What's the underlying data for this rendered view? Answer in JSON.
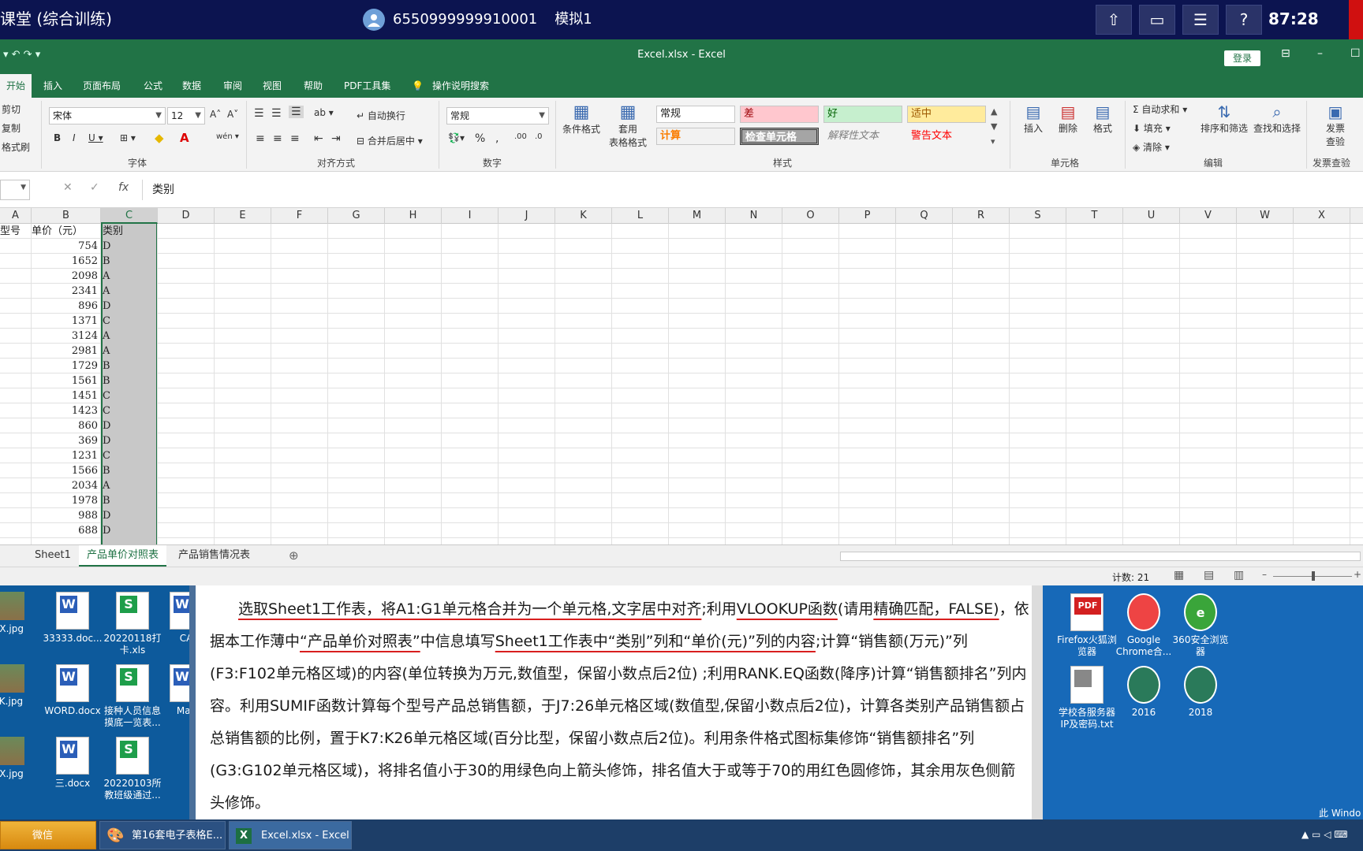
{
  "exam": {
    "title": "课堂 (综合训练)",
    "user_id": "6550999999910001",
    "mode": "模拟1",
    "timer": "87:28",
    "buttons": [
      "⇧",
      "▭",
      "☰",
      "?"
    ]
  },
  "excel": {
    "window_title": "Excel.xlsx  -  Excel",
    "login": "登录",
    "tabs": [
      "开始",
      "插入",
      "页面布局",
      "公式",
      "数据",
      "审阅",
      "视图",
      "帮助",
      "PDF工具集",
      "操作说明搜索"
    ],
    "ribbon": {
      "clipboard": [
        "剪切",
        "复制",
        "格式刷"
      ],
      "font_name": "宋体",
      "font_size": "12",
      "font_group": "字体",
      "align_group": "对齐方式",
      "wrap": "自动换行",
      "merge": "合并后居中",
      "number_format": "常规",
      "number_group": "数字",
      "cond_format": "条件格式",
      "table_format": "套用\n表格格式",
      "styles": [
        "常规",
        "差",
        "好",
        "适中",
        "计算",
        "检查单元格",
        "解释性文本",
        "警告文本"
      ],
      "styles_group": "样式",
      "cells": [
        "插入",
        "删除",
        "格式"
      ],
      "cells_group": "单元格",
      "edit": [
        "自动求和",
        "填充",
        "清除",
        "排序和筛选",
        "查找和选择"
      ],
      "edit_group": "编辑",
      "invoice": "发票\n查验",
      "invoice_group": "发票查验"
    },
    "formula": {
      "content": "类别"
    },
    "columns": [
      "A",
      "B",
      "C",
      "D",
      "E",
      "F",
      "G",
      "H",
      "I",
      "J",
      "K",
      "L",
      "M",
      "N",
      "O",
      "P",
      "Q",
      "R",
      "S",
      "T",
      "U",
      "V",
      "W",
      "X"
    ],
    "headers": {
      "a": "型号",
      "b": "单价（元）",
      "c": "类别"
    },
    "rows": [
      [
        "754",
        "D"
      ],
      [
        "1652",
        "B"
      ],
      [
        "2098",
        "A"
      ],
      [
        "2341",
        "A"
      ],
      [
        "896",
        "D"
      ],
      [
        "1371",
        "C"
      ],
      [
        "3124",
        "A"
      ],
      [
        "2981",
        "A"
      ],
      [
        "1729",
        "B"
      ],
      [
        "1561",
        "B"
      ],
      [
        "1451",
        "C"
      ],
      [
        "1423",
        "C"
      ],
      [
        "860",
        "D"
      ],
      [
        "369",
        "D"
      ],
      [
        "1231",
        "C"
      ],
      [
        "1566",
        "B"
      ],
      [
        "2034",
        "A"
      ],
      [
        "1978",
        "B"
      ],
      [
        "988",
        "D"
      ],
      [
        "688",
        "D"
      ]
    ],
    "sheets": [
      "Sheet1",
      "产品单价对照表",
      "产品销售情况表"
    ],
    "active_sheet": 1,
    "status_count": "计数: 21"
  },
  "question": {
    "text": "选取Sheet1工作表，将A1:G1单元格合并为一个单元格,文字居中对齐;利用VLOOKUP函数(请用精确匹配，FALSE)，依据本工作薄中“产品单价对照表”中信息填写Sheet1工作表中“类别”列和“单价(元)”列的内容;计算“销售额(万元)”列(F3:F102单元格区域)的内容(单位转换为万元,数值型，保留小数点后2位) ;利用RANK.EQ函数(降序)计算“销售额排名”列内容。利用SUMIF函数计算每个型号产品总销售额，于J7:26单元格区域(数值型,保留小数点后2位)，计算各类别产品销售额占总销售额的比例，置于K7:K26单元格区域(百分比型，保留小数点后2位)。利用条件格式图标集修饰“销售额排名”列(G3:G102单元格区域)，将排名值小于30的用绿色向上箭头修饰，排名值大于或等于70的用红色圆修饰，其余用灰色侧箭头修饰。"
  },
  "desktop": {
    "left_icons": [
      {
        "label": "GX.jpg",
        "type": "photo"
      },
      {
        "label": "33333.doc...",
        "type": "doc"
      },
      {
        "label": "20220118打卡.xls",
        "type": "xls"
      },
      {
        "label": "CA",
        "type": "doc"
      },
      {
        "label": "KK.jpg",
        "type": "photo"
      },
      {
        "label": "WORD.docx",
        "type": "doc"
      },
      {
        "label": "接种人员信息摸底一览表...",
        "type": "xls"
      },
      {
        "label": "Mac",
        "type": "doc"
      },
      {
        "label": "HX.jpg",
        "type": "photo"
      },
      {
        "label": "三.docx",
        "type": "doc"
      },
      {
        "label": "20220103所教班级通过...",
        "type": "xls"
      }
    ],
    "right_icons": [
      {
        "label": "Firefox火狐浏览器",
        "type": "pdf"
      },
      {
        "label": "Google Chrome合...",
        "type": "chrome"
      },
      {
        "label": "360安全浏览器",
        "type": "360"
      },
      {
        "label": "学校各服务器IP及密码.txt",
        "type": "txt"
      },
      {
        "label": "2016",
        "type": "seal"
      },
      {
        "label": "2018",
        "type": "seal"
      }
    ],
    "corner_text": "此 Windo"
  },
  "taskbar": {
    "items": [
      "微信",
      "第16套电子表格E...",
      "Excel.xlsx - Excel"
    ]
  },
  "colors": {
    "excel_green": "#217346",
    "exam_bar": "#0c1450",
    "underline": "#d81e1e"
  }
}
